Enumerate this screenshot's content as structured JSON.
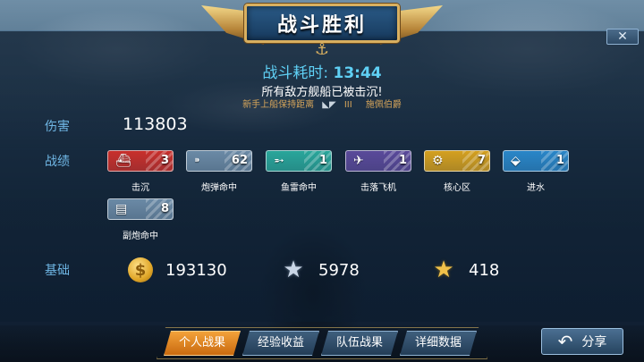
{
  "header": {
    "title": "战斗胜利",
    "close_icon": "close-icon"
  },
  "battle": {
    "time_label": "战斗耗时: ",
    "time_value": "13:44",
    "result": "所有敌方舰船已被击沉!",
    "sub_left": "新手上船保持距离",
    "sub_sep": "III",
    "sub_right": "施佩伯爵"
  },
  "stats": {
    "damage_label": "伤害",
    "damage_value": "113803",
    "achievements_label": "战绩",
    "base_label": "基础",
    "medals": [
      {
        "name": "击沉",
        "count": "3",
        "icon": "ship-icon",
        "color": "#c8302c"
      },
      {
        "name": "炮弹命中",
        "count": "62",
        "icon": "shell-icon",
        "color": "#6b8aa6"
      },
      {
        "name": "鱼雷命中",
        "count": "1",
        "icon": "torpedo-icon",
        "color": "#2aa69b"
      },
      {
        "name": "击落飞机",
        "count": "1",
        "icon": "plane-icon",
        "color": "#5a4a9a"
      },
      {
        "name": "核心区",
        "count": "7",
        "icon": "citadel-icon",
        "color": "#d4a020"
      },
      {
        "name": "进水",
        "count": "1",
        "icon": "flooding-icon",
        "color": "#2a86c8"
      },
      {
        "name": "副炮命中",
        "count": "8",
        "icon": "secondary-gun-icon",
        "color": "#6b8aa6"
      }
    ],
    "base": [
      {
        "icon": "coin-icon",
        "value": "193130"
      },
      {
        "icon": "silver-star-icon",
        "value": "5978"
      },
      {
        "icon": "gold-star-icon",
        "value": "418"
      }
    ]
  },
  "tabs": [
    {
      "label": "个人战果",
      "active": true
    },
    {
      "label": "经验收益",
      "active": false
    },
    {
      "label": "队伍战果",
      "active": false
    },
    {
      "label": "详细数据",
      "active": false
    }
  ],
  "share": {
    "label": "分享",
    "icon": "share-arrow-icon"
  }
}
